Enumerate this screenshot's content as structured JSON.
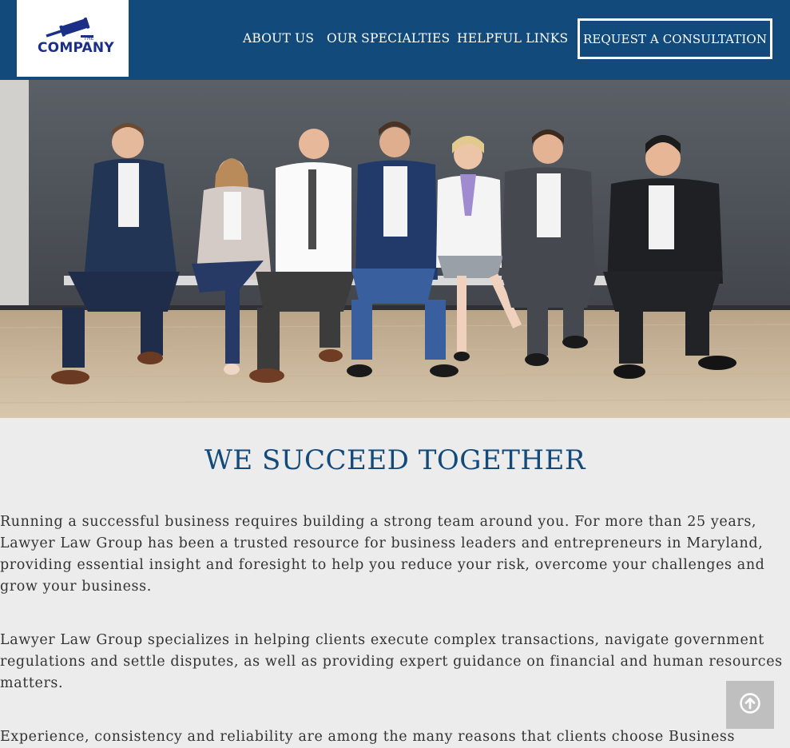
{
  "brand": {
    "logo_small": "THE",
    "logo_name": "COMPANY",
    "header_color": "#134a7c",
    "accent_color": "#134a7c"
  },
  "nav": {
    "items": [
      {
        "label": "ABOUT US"
      },
      {
        "label": "OUR SPECIALTIES"
      },
      {
        "label": "HELPFUL LINKS"
      }
    ],
    "cta_label": "REQUEST A CONSULTATION"
  },
  "hero": {
    "image": "team-photo"
  },
  "main": {
    "title": "WE SUCCEED TOGETHER",
    "paragraphs": [
      {
        "lines": [
          "Running a successful business requires building a strong team around you. For more than 25 years,",
          "Lawyer Law Group has been a trusted resource for business leaders and entrepreneurs in Maryland,",
          "providing essential insight and foresight to help you reduce your risk, overcome your challenges and",
          "grow your business."
        ]
      },
      {
        "lines": [
          "Lawyer Law Group specializes in helping clients execute complex transactions, navigate government",
          "regulations and settle disputes, as well as providing expert guidance on financial and human resources",
          "matters."
        ]
      },
      {
        "lines": [
          "Experience, consistency and reliability are among the many reasons that clients choose Business"
        ]
      }
    ]
  },
  "scroll_top": {
    "icon": "arrow-up-circle-icon"
  }
}
